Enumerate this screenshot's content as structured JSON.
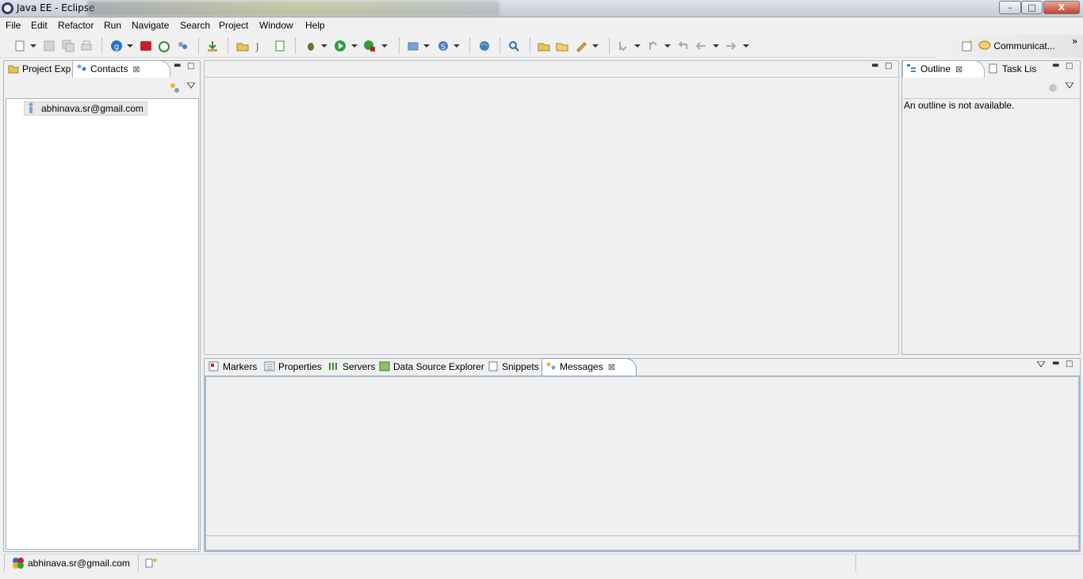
{
  "window": {
    "title": "Java EE - Eclipse",
    "buttons": {
      "minimize": "–",
      "maximize": "□",
      "close": "X"
    }
  },
  "menu": [
    "File",
    "Edit",
    "Refactor",
    "Run",
    "Navigate",
    "Search",
    "Project",
    "Window",
    "Help"
  ],
  "toolbar": {
    "perspective_label": "Communicat...",
    "more": "»"
  },
  "left_panel": {
    "tabs": [
      {
        "label": "Project Exp"
      },
      {
        "label": "Contacts",
        "active": true
      }
    ],
    "close_glyph": "⊠",
    "contacts": [
      "abhinava.sr@gmail.com"
    ]
  },
  "right_panel": {
    "tabs": [
      {
        "label": "Outline",
        "active": true
      },
      {
        "label": "Task Lis"
      }
    ],
    "close_glyph": "⊠",
    "message": "An outline is not available."
  },
  "bottom_panel": {
    "tabs": [
      {
        "label": "Markers"
      },
      {
        "label": "Properties"
      },
      {
        "label": "Servers"
      },
      {
        "label": "Data Source Explorer"
      },
      {
        "label": "Snippets"
      },
      {
        "label": "Messages",
        "active": true
      }
    ],
    "close_glyph": "⊠"
  },
  "status": {
    "account": "abhinava.sr@gmail.com"
  },
  "colors": {
    "panel_border": "#a9b3bf",
    "active_tab_border": "#7f9db9"
  }
}
